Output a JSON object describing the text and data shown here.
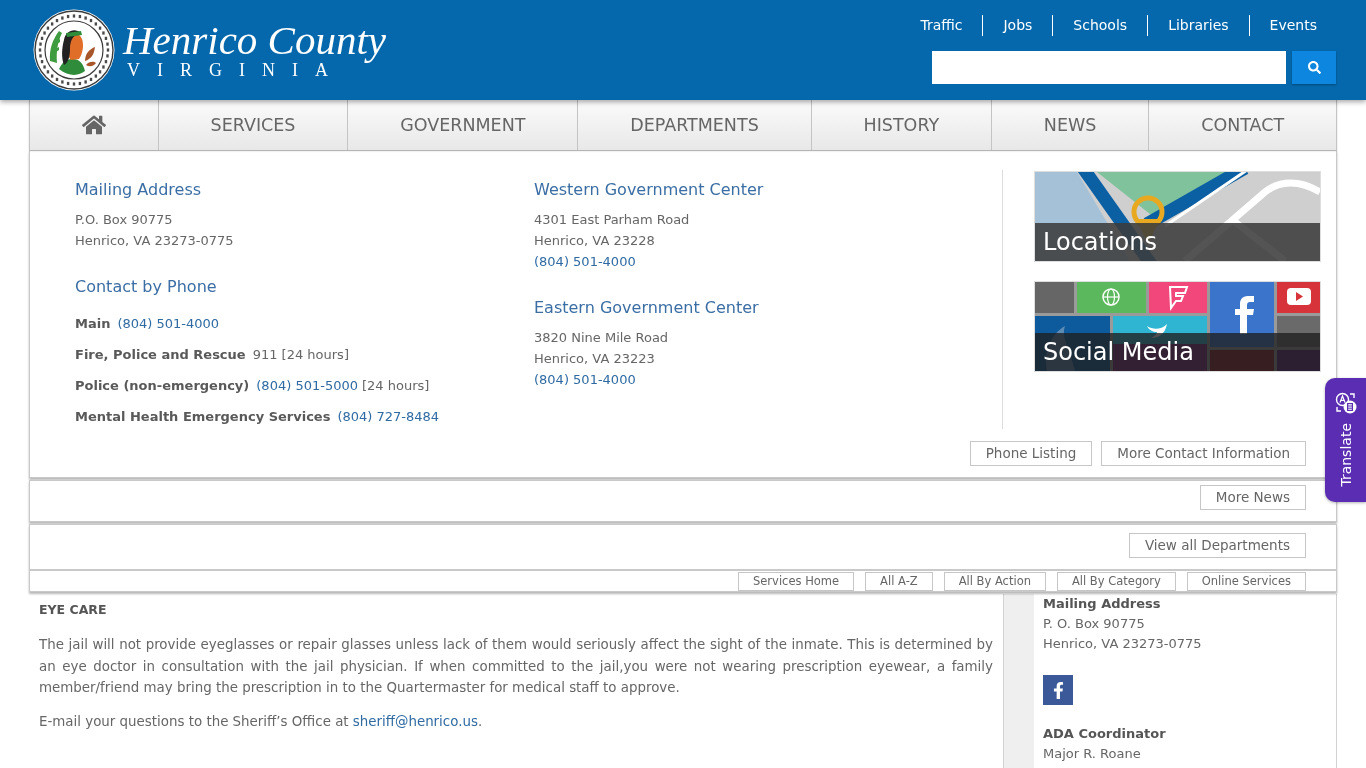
{
  "header": {
    "logo": {
      "title": "Henrico County",
      "subtitle": "VIRGINIA"
    },
    "top_links": [
      "Traffic",
      "Jobs",
      "Schools",
      "Libraries",
      "Events"
    ]
  },
  "nav": {
    "items": [
      {
        "kind": "icon"
      },
      {
        "kind": "text",
        "label": "SERVICES"
      },
      {
        "kind": "text",
        "label": "GOVERNMENT"
      },
      {
        "kind": "text",
        "label": "DEPARTMENTS"
      },
      {
        "kind": "text",
        "label": "HISTORY"
      },
      {
        "kind": "text",
        "label": "NEWS"
      },
      {
        "kind": "text",
        "label": "CONTACT"
      }
    ]
  },
  "contact_menu": {
    "columns": [
      {
        "sections": [
          {
            "heading": "Mailing Address",
            "lines": [
              "P.O. Box 90775",
              "Henrico, VA 23273-0775"
            ]
          },
          {
            "heading": "Contact by Phone",
            "phones": [
              {
                "label": "Main",
                "number": "(804) 501-4000"
              },
              {
                "label": "Fire, Police and Rescue",
                "note": "911 [24 hours]"
              },
              {
                "label": "Police (non-emergency)",
                "number": "(804) 501-5000",
                "note": "[24 hours]"
              },
              {
                "label": "Mental Health Emergency Services",
                "number": "(804) 727-8484"
              }
            ]
          }
        ]
      },
      {
        "sections": [
          {
            "heading": "Western Government Center",
            "lines": [
              "4301 East Parham Road",
              "Henrico, VA 23228"
            ],
            "phone": "(804) 501-4000"
          },
          {
            "heading": "Eastern Government Center",
            "lines": [
              "3820 Nine Mile Road",
              "Henrico, VA 23223"
            ],
            "phone": "(804) 501-4000"
          }
        ]
      }
    ],
    "tiles": [
      {
        "kind": "map",
        "label": "Locations"
      },
      {
        "kind": "social",
        "label": "Social Media"
      }
    ],
    "buttons": [
      "Phone Listing",
      "More Contact Information"
    ]
  },
  "news_menu": {
    "buttons": [
      "More News"
    ]
  },
  "departments_menu": {
    "buttons": [
      "View all Departments"
    ]
  },
  "services_menu": {
    "buttons": [
      "Services Home",
      "All A-Z",
      "All By Action",
      "All By Category",
      "Online Services"
    ]
  },
  "article": {
    "heading": "EYE CARE",
    "paragraphs": [
      "The jail will not provide eyeglasses or repair glasses unless lack of them would seriously affect the sight of the inmate. This is determined by an eye doctor in consultation with the jail physician. If when committed to the jail,you were not wearing prescription eyewear, a family member/friend may bring the prescription in to the Quartermaster for medical staff to approve."
    ],
    "contact": {
      "text": "E-mail your questions to the Sheriff’s Office at",
      "link": "sheriff@henrico.us",
      "after": "."
    }
  },
  "sidebar": {
    "blocks": [
      {
        "kind": "contact",
        "heading": "Mailing Address",
        "lines": [
          "P. O. Box 90775",
          "Henrico, VA 23273-0775"
        ]
      },
      {
        "kind": "social_links"
      },
      {
        "kind": "contact",
        "heading": "ADA Coordinator",
        "lines": [
          "Major R. Roane"
        ]
      }
    ]
  },
  "translate": {
    "label": "Translate"
  }
}
